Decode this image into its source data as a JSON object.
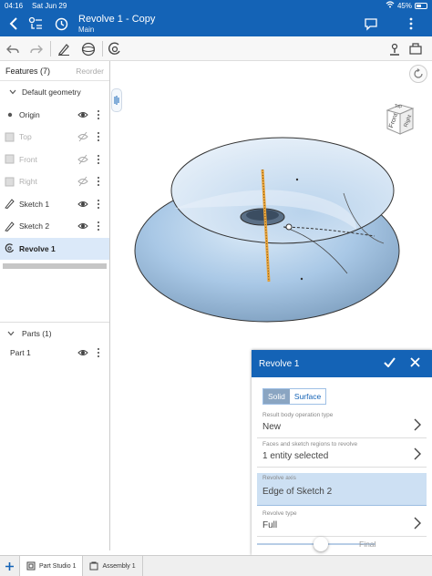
{
  "status_bar": {
    "time": "04:16",
    "date": "Sat Jun 29",
    "battery": "45%"
  },
  "title_bar": {
    "title": "Revolve 1 - Copy",
    "branch": "Main"
  },
  "features": {
    "title": "Features (7)",
    "reorder": "Reorder",
    "group": "Default geometry",
    "items": [
      {
        "label": "Origin"
      },
      {
        "label": "Top"
      },
      {
        "label": "Front"
      },
      {
        "label": "Right"
      },
      {
        "label": "Sketch 1"
      },
      {
        "label": "Sketch 2"
      },
      {
        "label": "Revolve 1"
      }
    ]
  },
  "parts": {
    "title": "Parts (1)",
    "items": [
      {
        "label": "Part 1"
      }
    ]
  },
  "view_cube": {
    "front": "Front",
    "top": "Top",
    "right": "Right"
  },
  "revolve_panel": {
    "title": "Revolve 1",
    "solid_label": "Solid",
    "surface_label": "Surface",
    "fields": [
      {
        "caption": "Result body operation type",
        "value": "New"
      },
      {
        "caption": "Faces and sketch regions to revolve",
        "value": "1 entity selected"
      },
      {
        "caption": "Revolve axis",
        "value": "Edge of Sketch 2"
      },
      {
        "caption": "Revolve type",
        "value": "Full"
      }
    ],
    "final_label": "Final"
  },
  "tabs": [
    {
      "label": "Part Studio 1"
    },
    {
      "label": "Assembly 1"
    }
  ],
  "colors": {
    "accent": "#1463b6",
    "torus": "#a9c8e6",
    "axis": "#e8a33a"
  }
}
